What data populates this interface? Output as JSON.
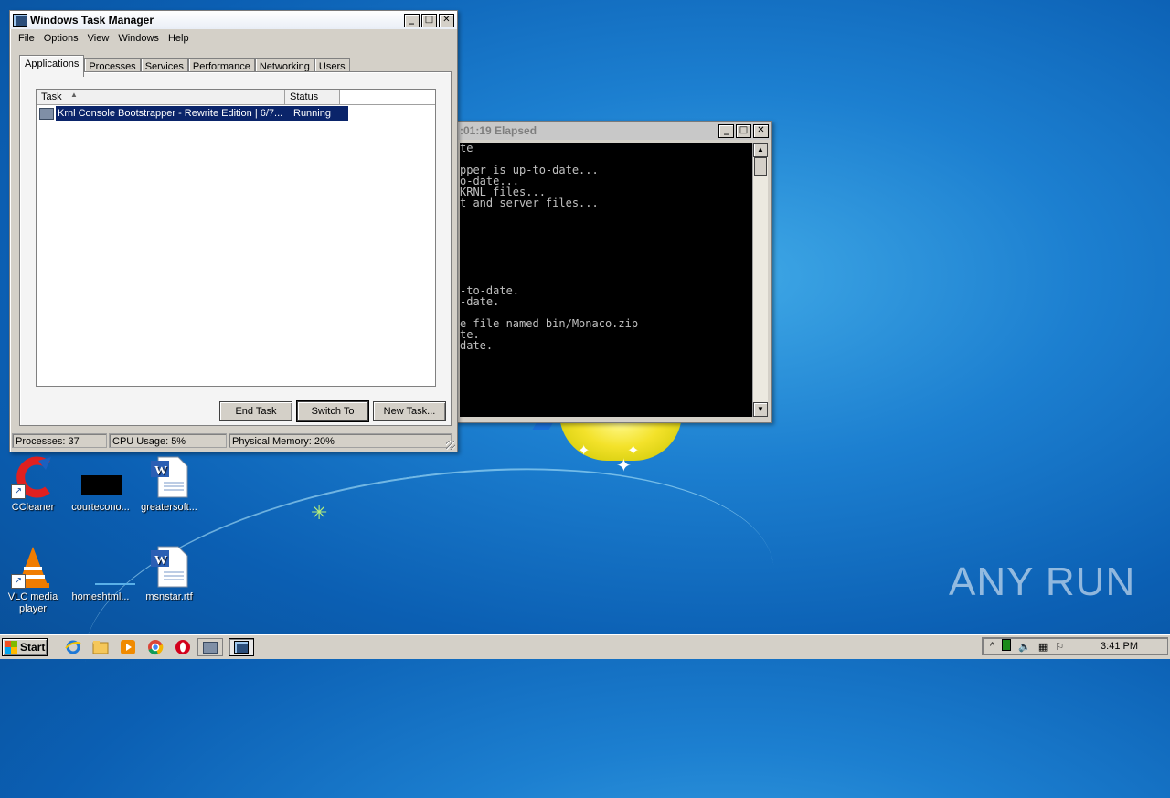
{
  "taskmgr": {
    "title": "Windows Task Manager",
    "menu": [
      "File",
      "Options",
      "View",
      "Windows",
      "Help"
    ],
    "tabs": [
      "Applications",
      "Processes",
      "Services",
      "Performance",
      "Networking",
      "Users"
    ],
    "selected_tab": "Applications",
    "columns": {
      "task": "Task",
      "status": "Status"
    },
    "rows": [
      {
        "task": "Krnl Console Bootstrapper - Rewrite Edition | 6/7...",
        "status": "Running"
      }
    ],
    "buttons": {
      "end_task": "End Task",
      "switch_to": "Switch To",
      "new_task": "New Task..."
    },
    "status": {
      "processes": "Processes: 37",
      "cpu": "CPU Usage: 5%",
      "memory": "Physical Memory: 20%"
    },
    "window_buttons": {
      "minimize": "_",
      "maximize": "□",
      "close": "✕"
    }
  },
  "console": {
    "title": ":01:19 Elapsed",
    "lines": [
      "te",
      "",
      "pper is up-to-date...",
      "o-date...",
      "KRNL files...",
      "t and server files...",
      "",
      "",
      "",
      "",
      "",
      "",
      "",
      "-to-date.",
      "-date.",
      "",
      "e file named bin/Monaco.zip",
      "te.",
      "date."
    ],
    "scroll_up": "▲",
    "scroll_down": "▼"
  },
  "desktop": {
    "icons": [
      {
        "label": "CCleaner"
      },
      {
        "label": "courtecono..."
      },
      {
        "label": "greatersoft..."
      },
      {
        "label": "VLC media player"
      },
      {
        "label": "homeshtml..."
      },
      {
        "label": "msnstar.rtf"
      }
    ],
    "watermark": "ANY RUN"
  },
  "taskbar": {
    "start_label": "Start",
    "clock": "3:41 PM",
    "tray_expand": "^"
  },
  "colors": {
    "selection": "#0a246a",
    "desktop_blue": "#1c7fd0",
    "console_bg": "#000000"
  }
}
